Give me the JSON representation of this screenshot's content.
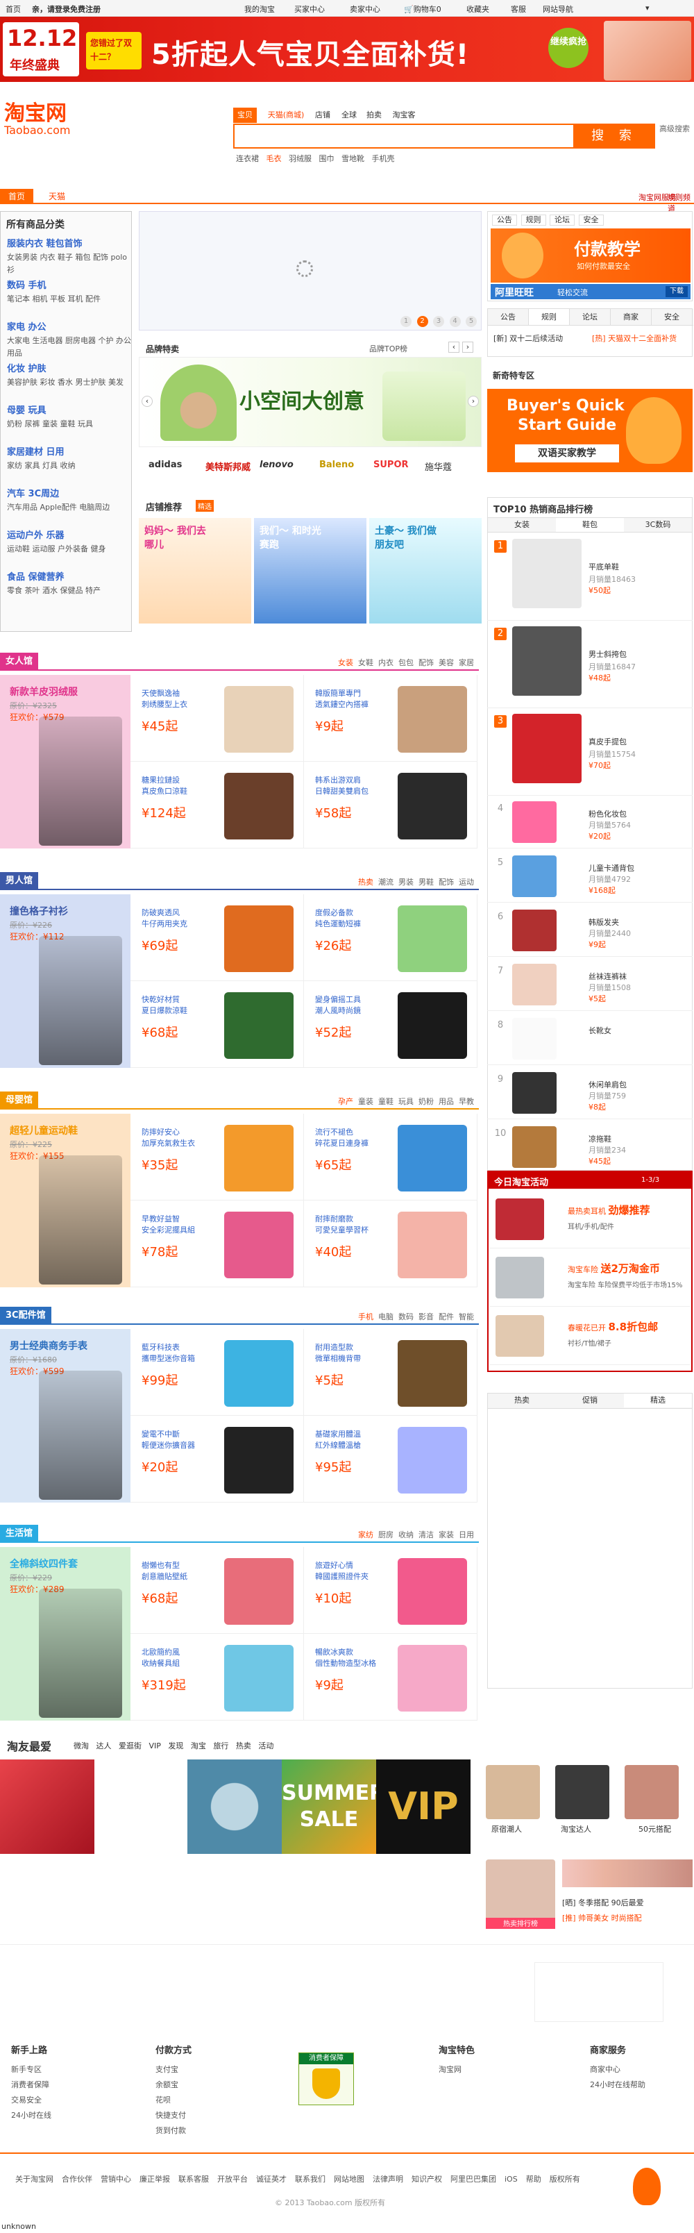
{
  "topbar": {
    "home": "首页",
    "login": "亲，请登录免费注册",
    "myTaobao": "我的淘宝",
    "buyer": "买家中心",
    "seller": "卖家中心",
    "cart": "购物车0",
    "fav": "收藏夹",
    "service": "客服",
    "more": "网站导航"
  },
  "banner": {
    "badge_top": "12.12",
    "badge_bottom": "年终盛典",
    "tag": "您错过了双十二？",
    "headline": "5折起人气宝贝全面补货!",
    "cta": "继续疯抢"
  },
  "logo": {
    "cn": "淘宝网",
    "en": "Taobao.com"
  },
  "search": {
    "tabs": [
      "宝贝",
      "天猫(商城)",
      "店铺",
      "全球",
      "拍卖",
      "淘宝客"
    ],
    "button": "搜 索",
    "advanced": "高级搜索",
    "hot": [
      "连衣裙",
      "毛衣",
      "羽绒服",
      "围巾",
      "雪地靴",
      "手机壳"
    ]
  },
  "subnav": {
    "tabs": [
      "首页",
      "天猫"
    ],
    "right": [
      "淘宝网服务",
      "规则频道"
    ]
  },
  "categories": {
    "title": "所有商品分类",
    "groups": [
      {
        "head": "服装内衣 鞋包首饰",
        "sub": "女装男装 内衣 鞋子 箱包 配饰 polo衫"
      },
      {
        "head": "数码 手机",
        "sub": "笔记本 相机 平板 耳机 配件"
      },
      {
        "head": "家电 办公",
        "sub": "大家电 生活电器 厨房电器 个护 办公用品"
      },
      {
        "head": "化妆 护肤",
        "sub": "美容护肤 彩妆 香水 男士护肤 美发"
      },
      {
        "head": "母婴 玩具",
        "sub": "奶粉 尿裤 童装 童鞋 玩具"
      },
      {
        "head": "家居建材 日用",
        "sub": "家纺 家具 灯具 收纳"
      },
      {
        "head": "汽车 3C周边",
        "sub": "汽车用品 Apple配件 电脑周边"
      },
      {
        "head": "运动户外 乐器",
        "sub": "运动鞋 运动服 户外装备 健身"
      },
      {
        "head": "食品 保健营养",
        "sub": "零食 茶叶 酒水 保健品 特产"
      }
    ]
  },
  "carousel": {
    "dots": [
      "1",
      "2",
      "3",
      "4",
      "5"
    ],
    "active": "2"
  },
  "brandbar": {
    "title": "品牌特卖",
    "link": "品牌TOP榜",
    "headline": "小空间大创意",
    "brands": [
      "adidas",
      "美特斯邦威",
      "lenovo",
      "Baleno",
      "SUPOR",
      "施华蔻"
    ]
  },
  "shopRec": {
    "title": "店铺推荐",
    "tag": "精选",
    "panels": [
      "妈妈～ 我们去哪儿",
      "我们～ 和时光赛跑",
      "土豪～ 我们做朋友吧"
    ]
  },
  "notice": {
    "tabs": [
      "公告",
      "规则",
      "论坛",
      "安全"
    ],
    "pay_title": "付款教学",
    "pay_sub": "如何付款最安全",
    "aliww": "阿里旺旺",
    "aliww_sub": "轻松交流",
    "dl": "下载"
  },
  "newbie": {
    "tabs": [
      "公告",
      "规则",
      "论坛",
      "商家",
      "安全"
    ],
    "line1": "[新] 双十二后续活动",
    "line2": "[热] 天猫双十二全面补货"
  },
  "newbiezone": {
    "title": "新奇特专区",
    "guide1": "Buyer's Quick",
    "guide2": "Start Guide",
    "guide3": "双语买家教学"
  },
  "top10": {
    "title": "TOP10 热销商品排行榜",
    "tabs": [
      "女装",
      "鞋包",
      "3C数码"
    ],
    "items": [
      {
        "no": "1",
        "name": "平底单鞋",
        "sales": "月销量18463",
        "price": "50"
      },
      {
        "no": "2",
        "name": "男士斜挎包",
        "sales": "月销量16847",
        "price": "48"
      },
      {
        "no": "3",
        "name": "真皮手提包",
        "sales": "月销量15754",
        "price": "70"
      },
      {
        "no": "4",
        "name": "粉色化妆包",
        "sales": "月销量5764",
        "price": "20"
      },
      {
        "no": "5",
        "name": "儿童卡通背包",
        "sales": "月销量4792",
        "price": "168"
      },
      {
        "no": "6",
        "name": "韩版发夹",
        "sales": "月销量2440",
        "price": "9"
      },
      {
        "no": "7",
        "name": "丝袜连裤袜",
        "sales": "月销量1508",
        "price": "5"
      },
      {
        "no": "8",
        "name": "长靴女",
        "sales": "",
        "price": ""
      },
      {
        "no": "9",
        "name": "休闲单肩包",
        "sales": "月销量759",
        "price": "8"
      },
      {
        "no": "10",
        "name": "凉拖鞋",
        "sales": "月销量234",
        "price": "45"
      }
    ]
  },
  "events": {
    "title": "今日淘宝活动",
    "page": "1-3/3",
    "items": [
      {
        "t1": "最热卖耳机",
        "t2": "劲爆推荐",
        "d": "耳机/手机/配件"
      },
      {
        "t1": "淘宝车险",
        "t2": "送2万淘金币",
        "d": "淘宝车险 车险保费平均低于市场15%"
      },
      {
        "t1": "春暖花已开",
        "t2": "8.8折包邮",
        "d": "衬衫/T恤/裙子"
      }
    ]
  },
  "bottomtabs": [
    "热卖",
    "促销",
    "精选"
  ],
  "sections": [
    {
      "name": "女人馆",
      "color": "#e0338b",
      "links": [
        "女装",
        "女鞋",
        "内衣",
        "包包",
        "配饰",
        "美容",
        "家居"
      ],
      "feat": {
        "title": "新款羊皮羽绒服",
        "orig": "原价：¥2325",
        "now": "狂欢价：¥579",
        "bg": "#f9cbe0"
      },
      "cells": [
        {
          "a": "天使飘逸袖",
          "b": "刺绣腰型上衣",
          "p": "¥45起"
        },
        {
          "a": "韓版簡單專門",
          "b": "透氣鏤空內搭褲",
          "p": "¥9起"
        },
        {
          "a": "糖果拉鏈設",
          "b": "真皮魚口涼鞋",
          "p": "¥124起"
        },
        {
          "a": "韩系出游双肩",
          "b": "日韓甜美雙肩包",
          "p": "¥58起"
        }
      ]
    },
    {
      "name": "男人馆",
      "color": "#3c59a8",
      "links": [
        "热卖",
        "潮流",
        "男装",
        "男鞋",
        "配饰",
        "运动"
      ],
      "feat": {
        "title": "撞色格子衬衫",
        "orig": "原价：¥226",
        "now": "狂欢价：¥112",
        "bg": "#d4def5"
      },
      "cells": [
        {
          "a": "防破爽透风",
          "b": "牛仔两用夹克",
          "p": "¥69起"
        },
        {
          "a": "度假必备款",
          "b": "純色運動短褲",
          "p": "¥26起"
        },
        {
          "a": "快乾好材質",
          "b": "夏日爆款涼鞋",
          "p": "¥68起"
        },
        {
          "a": "變身偏摇工具",
          "b": "潮人風時尚鏡",
          "p": "¥52起"
        }
      ]
    },
    {
      "name": "母婴馆",
      "color": "#f39800",
      "links": [
        "孕产",
        "童装",
        "童鞋",
        "玩具",
        "奶粉",
        "用品",
        "早教"
      ],
      "feat": {
        "title": "超轻儿童运动鞋",
        "orig": "原价：¥225",
        "now": "狂欢价：¥155",
        "bg": "#fde3c4"
      },
      "cells": [
        {
          "a": "防摔好安心",
          "b": "加厚充氣救生衣",
          "p": "¥35起"
        },
        {
          "a": "流行不褪色",
          "b": "碎花夏日連身褲",
          "p": "¥65起"
        },
        {
          "a": "早教好益智",
          "b": "安全彩泥擺具組",
          "p": "¥78起"
        },
        {
          "a": "耐摔耐磨款",
          "b": "可愛兒童學習杯",
          "p": "¥40起"
        }
      ]
    },
    {
      "name": "3C配件馆",
      "color": "#2c6fbe",
      "links": [
        "手机",
        "电脑",
        "数码",
        "影音",
        "配件",
        "智能"
      ],
      "feat": {
        "title": "男士经典商务手表",
        "orig": "原价：¥1680",
        "now": "狂欢价：¥599",
        "bg": "#d9e6f6"
      },
      "cells": [
        {
          "a": "藍牙科技表",
          "b": "攜帶型迷你音箱",
          "p": "¥99起"
        },
        {
          "a": "耐用造型款",
          "b": "微單相機背帶",
          "p": "¥5起"
        },
        {
          "a": "變電不中斷",
          "b": "輕便迷你擴音器",
          "p": "¥20起"
        },
        {
          "a": "基礎家用體溫",
          "b": "紅外線體溫槍",
          "p": "¥95起"
        }
      ]
    },
    {
      "name": "生活馆",
      "color": "#29abe2",
      "links": [
        "家纺",
        "厨房",
        "收纳",
        "清洁",
        "家装",
        "日用"
      ],
      "feat": {
        "title": "全棉斜纹四件套",
        "orig": "原价：¥229",
        "now": "狂欢价：¥289",
        "bg": "#d2f0d4"
      },
      "cells": [
        {
          "a": "樹懶也有型",
          "b": "創意牆貼壁紙",
          "p": "¥68起"
        },
        {
          "a": "旅遊好心情",
          "b": "韓國護照證件夾",
          "p": "¥10起"
        },
        {
          "a": "北歐簡約風",
          "b": "收納餐具組",
          "p": "¥319起"
        },
        {
          "a": "暢飲冰爽款",
          "b": "個性動物造型冰格",
          "p": "¥9起"
        }
      ]
    }
  ],
  "friends": {
    "title": "淘友最爱",
    "tabs": [
      "微淘",
      "达人",
      "爱逛街",
      "VIP",
      "发现",
      "淘宝",
      "旅行",
      "热卖",
      "活动"
    ],
    "names": [
      "原宿潮人",
      "淘宝达人",
      "50元搭配"
    ],
    "hot": "热卖排行榜",
    "line1": "[晒] 冬季搭配 90后最爱",
    "line2": "[推] 帅哥美女 时尚搭配"
  },
  "footer": {
    "cols": [
      {
        "h": "新手上路",
        "items": [
          "新手专区",
          "消费者保障",
          "交易安全",
          "24小时在线"
        ]
      },
      {
        "h": "付款方式",
        "items": [
          "支付宝",
          "余额宝",
          "花呗",
          "快捷支付",
          "货到付款"
        ]
      },
      {
        "h": "淘宝特色",
        "items": [
          "淘宝网"
        ]
      },
      {
        "h": "商家服务",
        "items": [
          "商家中心",
          "24小时在线帮助"
        ]
      }
    ],
    "badge": "消费者保障",
    "links": [
      "关于淘宝网",
      "合作伙伴",
      "营销中心",
      "廉正举报",
      "联系客服",
      "开放平台",
      "诚征英才",
      "联系我们",
      "网站地图",
      "法律声明",
      "知识产权",
      "阿里巴巴集团",
      "iOS",
      "帮助",
      "版权所有"
    ],
    "copyright": "© 2013 Taobao.com 版权所有",
    "status": "unknown"
  }
}
